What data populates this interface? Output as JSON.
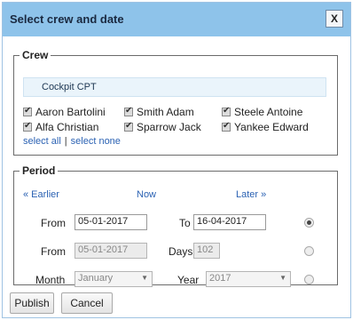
{
  "dialog": {
    "title": "Select crew and date",
    "close_label": "X"
  },
  "crew": {
    "legend": "Crew",
    "group": "Cockpit CPT",
    "members": [
      {
        "name": "Aaron Bartolini",
        "checked": true
      },
      {
        "name": "Smith Adam",
        "checked": true
      },
      {
        "name": "Steele Antoine",
        "checked": true
      },
      {
        "name": "Alfa Christian",
        "checked": true
      },
      {
        "name": "Sparrow Jack",
        "checked": true
      },
      {
        "name": "Yankee Edward",
        "checked": true
      }
    ],
    "select_all": "select all",
    "separator": "|",
    "select_none": "select none"
  },
  "period": {
    "legend": "Period",
    "earlier": "« Earlier",
    "now": "Now",
    "later": "Later »",
    "row1": {
      "from_label": "From",
      "from_value": "05-01-2017",
      "to_label": "To",
      "to_value": "16-04-2017",
      "selected": true
    },
    "row2": {
      "from_label": "From",
      "from_value": "05-01-2017",
      "days_label": "Days",
      "days_value": "102",
      "selected": false
    },
    "row3": {
      "month_label": "Month",
      "month_value": "January",
      "year_label": "Year",
      "year_value": "2017",
      "selected": false
    }
  },
  "buttons": {
    "publish": "Publish",
    "cancel": "Cancel"
  }
}
